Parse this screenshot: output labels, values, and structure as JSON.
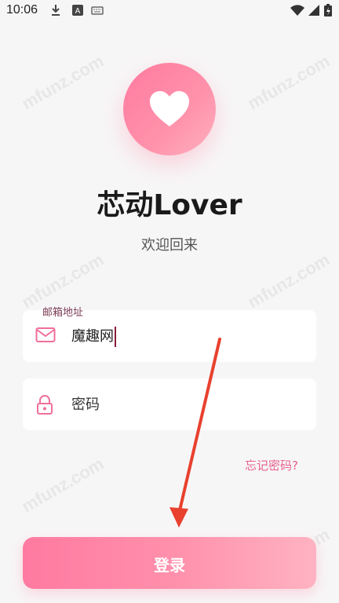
{
  "status_bar": {
    "time": "10:06",
    "left_icons": [
      "download-icon",
      "font-icon",
      "keyboard-icon"
    ],
    "right_icons": [
      "wifi-icon",
      "signal-icon",
      "battery-charging-icon"
    ]
  },
  "watermark": "mfunz.com",
  "logo": {
    "icon": "heart-icon"
  },
  "app": {
    "title": "芯动Lover",
    "subtitle": "欢迎回来"
  },
  "form": {
    "email": {
      "label": "邮箱地址",
      "value": "魔趣网",
      "icon": "mail-icon"
    },
    "password": {
      "placeholder": "密码",
      "icon": "lock-icon"
    },
    "forgot_link": "忘记密码?"
  },
  "login_button": {
    "label": "登录"
  },
  "colors": {
    "accent": "#ff7aa0",
    "link": "#e9628c",
    "annotation_arrow": "#e8412e"
  }
}
